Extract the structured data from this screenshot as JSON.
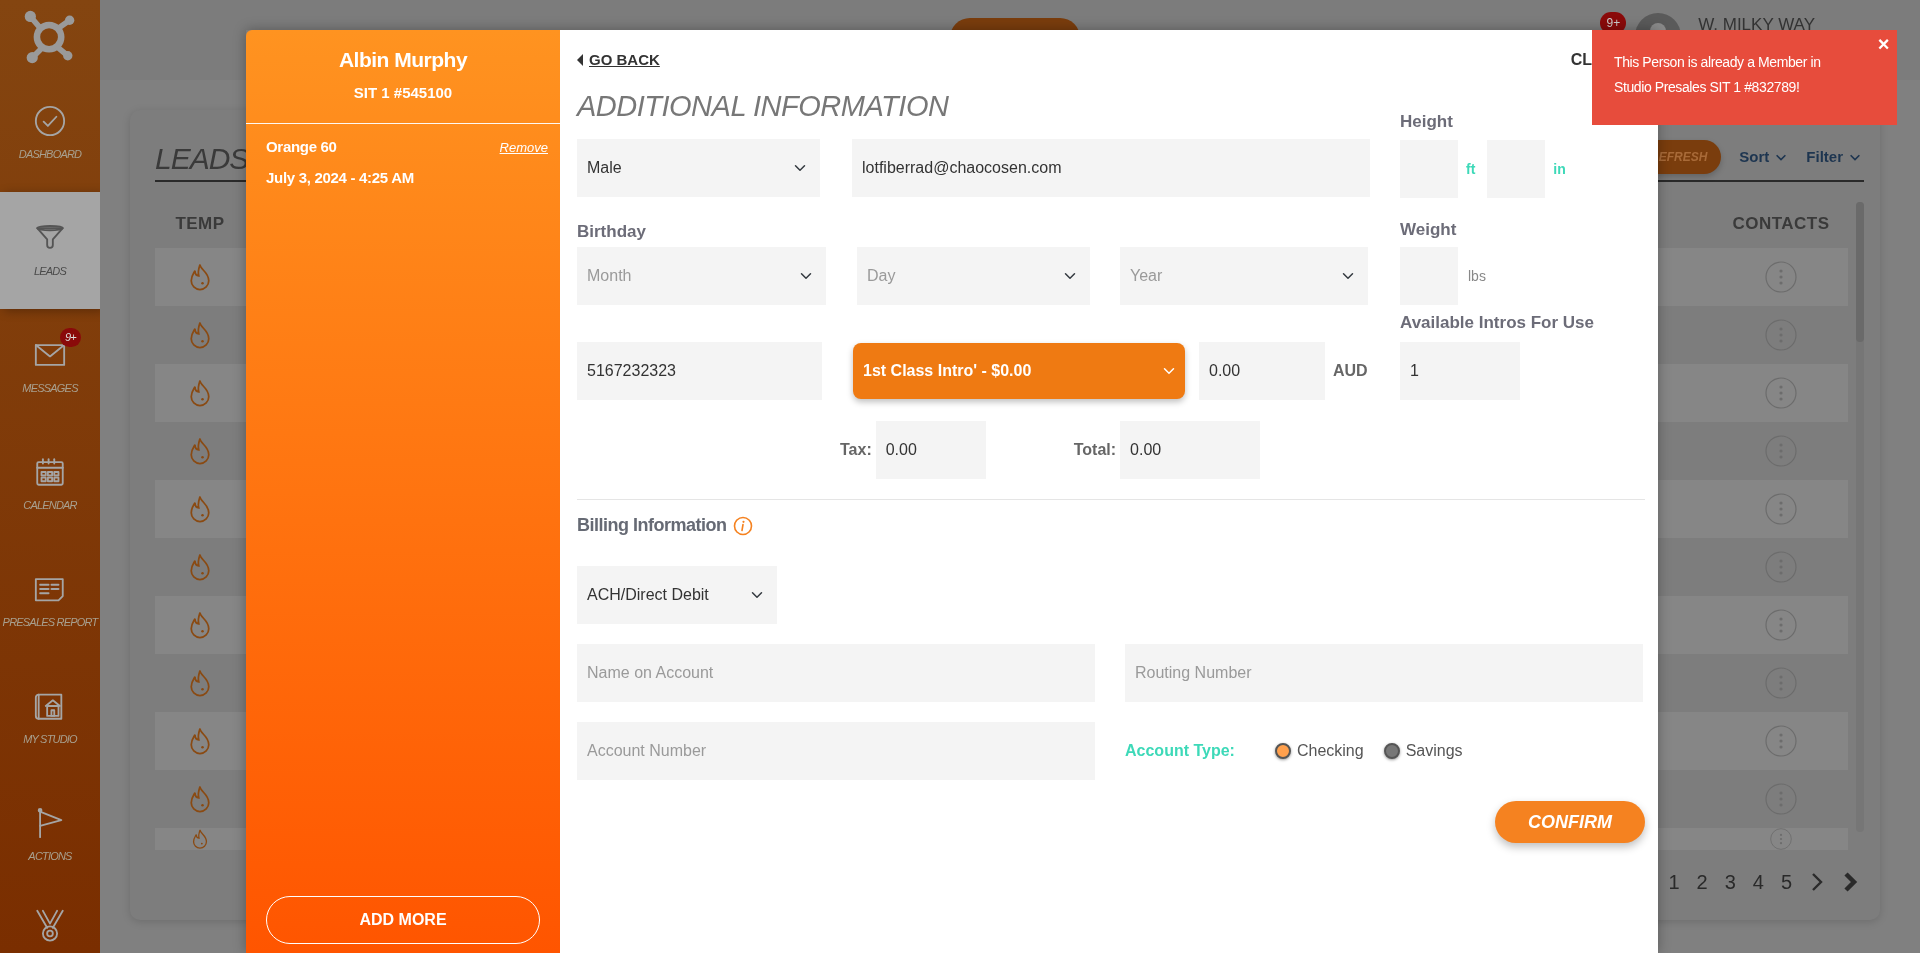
{
  "sidebar": {
    "items": [
      {
        "kind": "check",
        "label": "DASHBOARD",
        "selected": false
      },
      {
        "kind": "funnel",
        "label": "LEADS",
        "selected": true
      },
      {
        "kind": "mail",
        "label": "MESSAGES",
        "selected": false,
        "badge": "9+"
      },
      {
        "kind": "calendar",
        "label": "CALENDAR",
        "selected": false
      },
      {
        "kind": "report",
        "label": "PRESALES REPORT",
        "selected": false
      },
      {
        "kind": "studio",
        "label": "MY STUDIO",
        "selected": false
      },
      {
        "kind": "flag",
        "label": "ACTIONS",
        "selected": false
      },
      {
        "kind": "medal",
        "selected": false
      }
    ]
  },
  "header": {
    "notification_badge": "9+",
    "user_name": "W. MILKY WAY"
  },
  "leads": {
    "title": "LEADS",
    "refresh_button": "EFRESH",
    "sort": "Sort",
    "filter": "Filter",
    "columns": [
      "TEMP",
      "CONTACTS"
    ],
    "rows": [
      {
        "kind": "hot"
      },
      {
        "kind": "hot"
      },
      {
        "kind": "hot"
      },
      {
        "kind": "hot"
      },
      {
        "kind": "hot"
      },
      {
        "kind": "hot"
      },
      {
        "kind": "hot"
      },
      {
        "kind": "hot"
      },
      {
        "kind": "hot"
      },
      {
        "kind": "hot"
      },
      {
        "kind": "hot"
      }
    ],
    "pages": [
      "1",
      "2",
      "3",
      "4",
      "5"
    ]
  },
  "modal": {
    "customer": {
      "name": "Albin Murphy",
      "id": "SIT 1 #545100"
    },
    "items": [
      {
        "name": "Orange 60",
        "date": "July 3, 2024 - 4:25 AM",
        "remove": "Remove"
      }
    ],
    "add_more": "ADD MORE",
    "go_back": "GO BACK",
    "close": "CL",
    "additional_info": {
      "title": "ADDITIONAL INFORMATION",
      "gender": {
        "value": "Male"
      },
      "email": {
        "value": "lotfiberrad@chaocosen.com"
      },
      "birthday": {
        "label": "Birthday",
        "month": {
          "placeholder": "Month"
        },
        "day": {
          "placeholder": "Day"
        },
        "year": {
          "placeholder": "Year"
        }
      },
      "phone": {
        "value": "5167232323"
      },
      "intro": {
        "value": "1st Class Intro' - $0.00"
      },
      "amount": {
        "value": "0.00",
        "currency": "AUD"
      },
      "tax": {
        "label": "Tax:",
        "value": "0.00"
      },
      "total": {
        "label": "Total:",
        "value": "0.00"
      },
      "height": {
        "label": "Height",
        "feet_unit": "ft",
        "inches_unit": "in"
      },
      "weight": {
        "label": "Weight",
        "unit": "lbs"
      },
      "available_intros": {
        "label": "Available Intros For Use",
        "value": "1"
      }
    },
    "billing": {
      "title": "Billing Information",
      "method": {
        "value": "ACH/Direct Debit"
      },
      "name_on_account": {
        "placeholder": "Name on Account"
      },
      "routing_number": {
        "placeholder": "Routing Number"
      },
      "account_number": {
        "placeholder": "Account Number"
      },
      "account_type": {
        "label": "Account Type:",
        "options": [
          {
            "label": "Checking",
            "selected": true
          },
          {
            "label": "Savings",
            "selected": false
          }
        ]
      },
      "confirm": "CONFIRM"
    }
  },
  "toast": {
    "message": "This Person is already a Member in Studio Presales SIT 1 #832789!",
    "close": "×"
  }
}
